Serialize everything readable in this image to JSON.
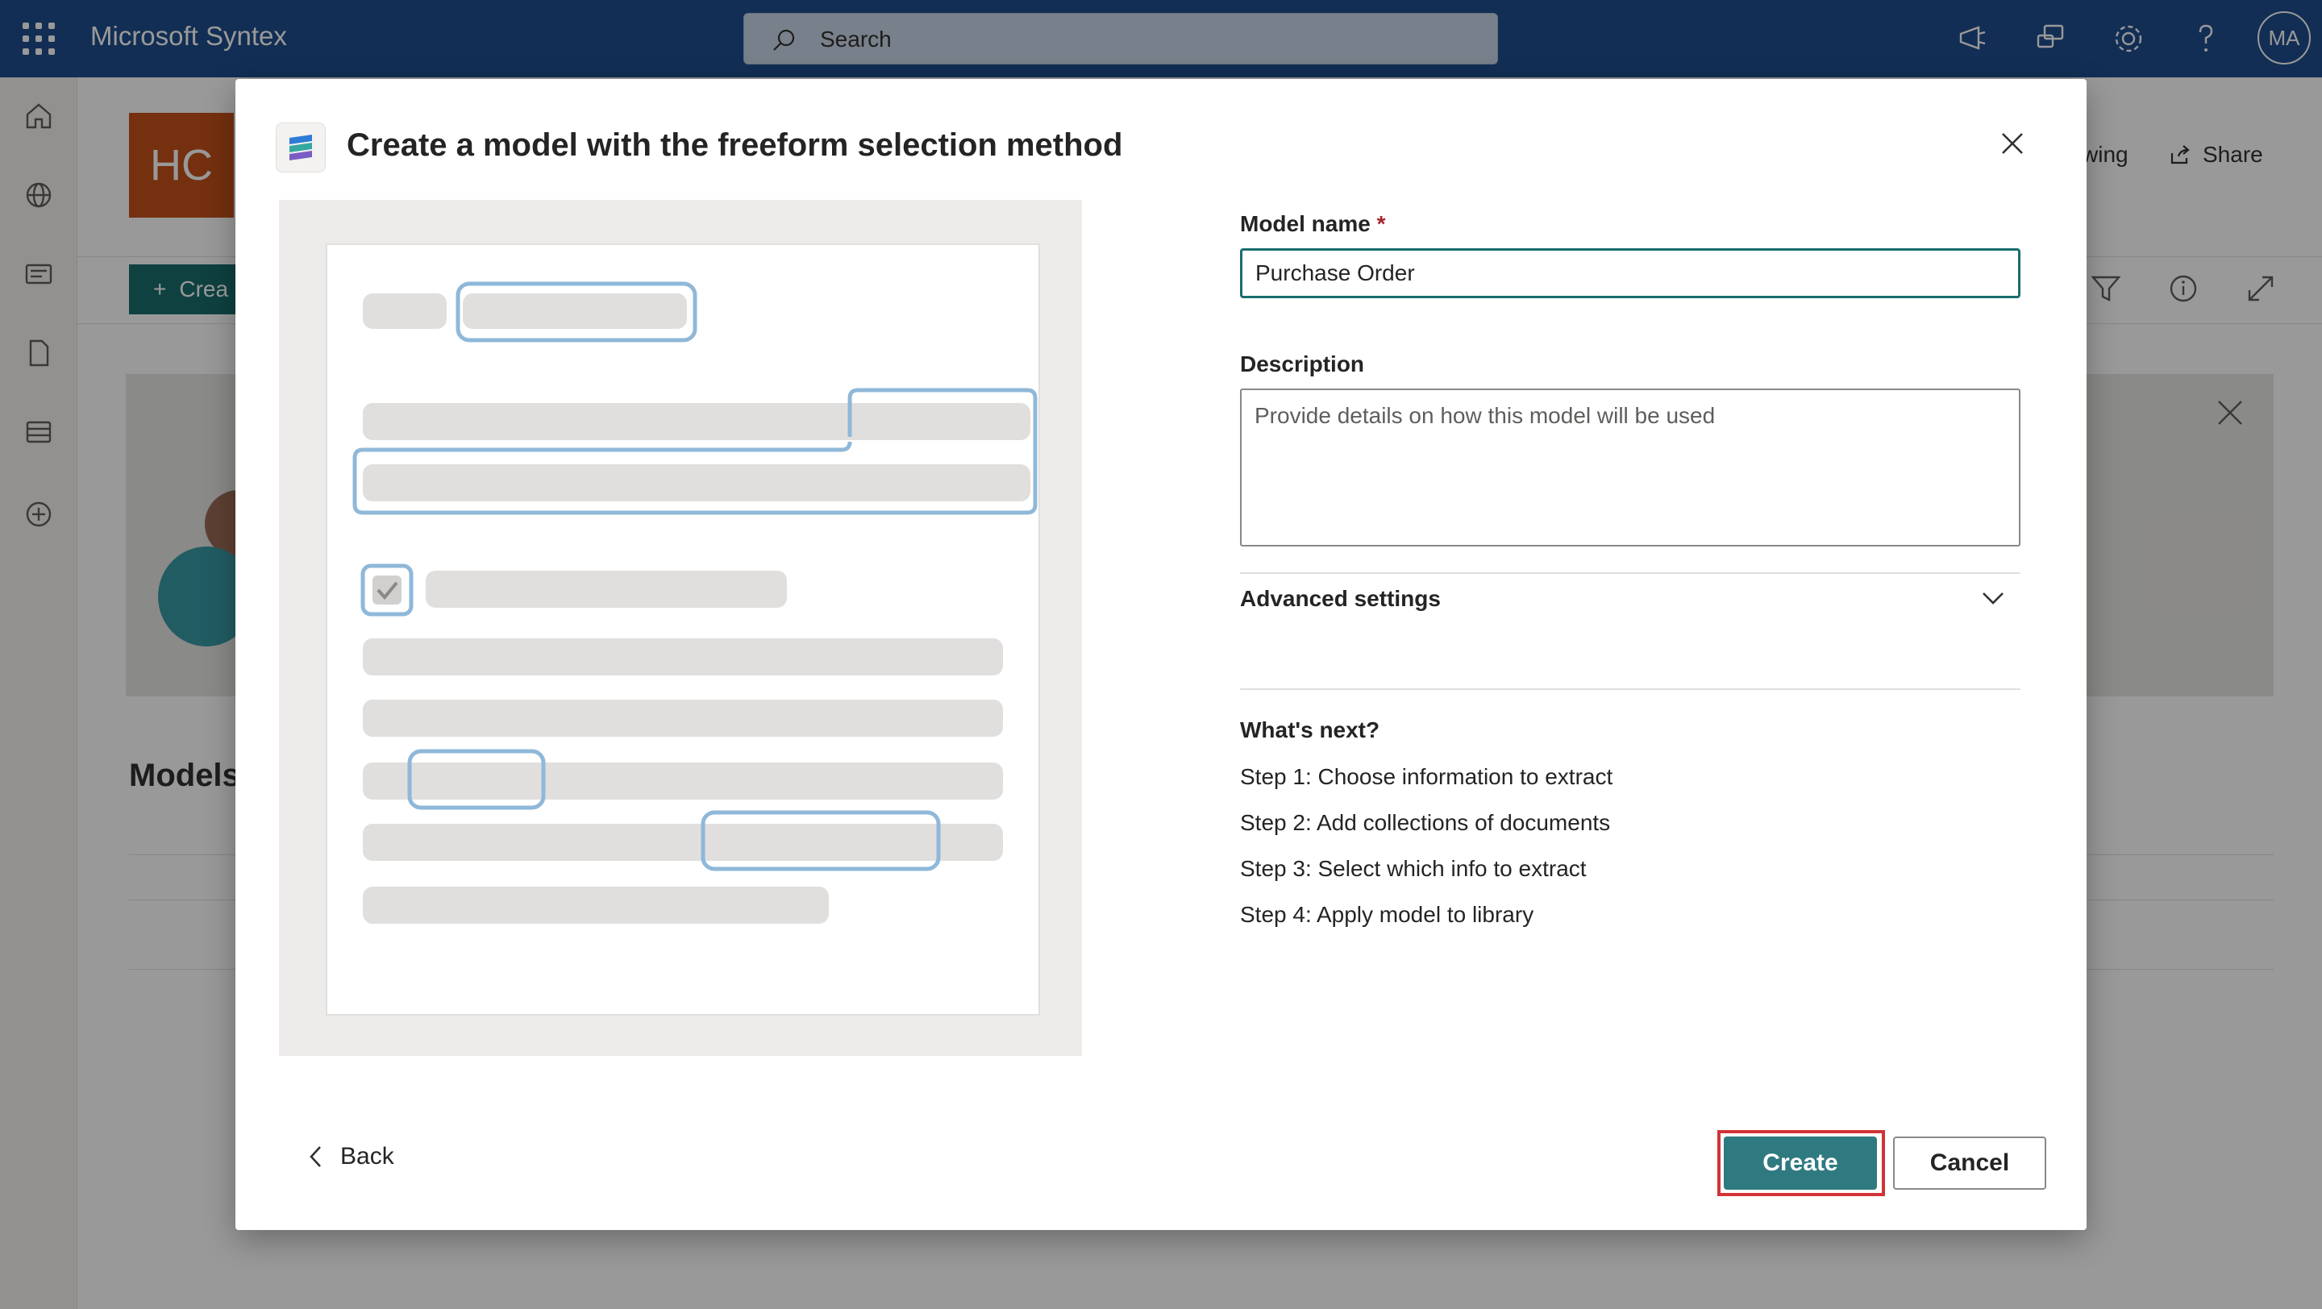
{
  "topbar": {
    "app_name": "Microsoft Syntex",
    "search_placeholder": "Search",
    "avatar_initials": "MA"
  },
  "site": {
    "logo_initials": "HC",
    "following_label": "wing",
    "share_label": "Share",
    "new_button_label": "Crea",
    "models_heading": "Models"
  },
  "dialog": {
    "title": "Create a model with the freeform selection method",
    "model_name_label": "Model name",
    "required_mark": "*",
    "model_name_value": "Purchase Order",
    "description_label": "Description",
    "description_placeholder": "Provide details on how this model will be used",
    "advanced_settings_label": "Advanced settings",
    "whats_next_heading": "What's next?",
    "steps": [
      "Step 1: Choose information to extract",
      "Step 2: Add collections of documents",
      "Step 3: Select which info to extract",
      "Step 4: Apply model to library"
    ],
    "back_label": "Back",
    "create_label": "Create",
    "cancel_label": "Cancel"
  },
  "colors": {
    "topbar": "#1f4e8c",
    "accent": "#1a6d6d",
    "create_button": "#2f7a80",
    "highlight": "#d13438",
    "selection_outline": "#8fb8d9"
  }
}
